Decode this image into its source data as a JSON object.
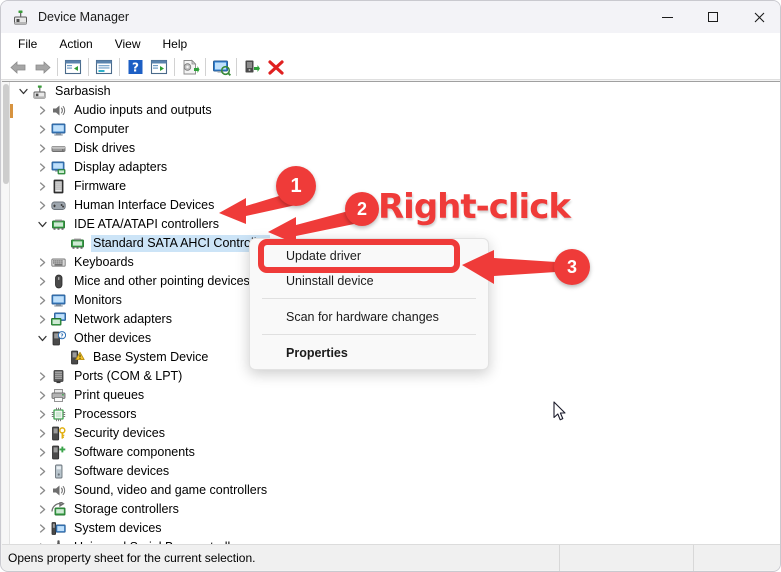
{
  "window": {
    "title": "Device Manager",
    "icon": "device-manager-icon",
    "controls": {
      "minimize": "–",
      "maximize": "☐",
      "close": "✕"
    }
  },
  "menubar": {
    "items": [
      {
        "label": "File",
        "name": "menu-file"
      },
      {
        "label": "Action",
        "name": "menu-action"
      },
      {
        "label": "View",
        "name": "menu-view"
      },
      {
        "label": "Help",
        "name": "menu-help"
      }
    ]
  },
  "toolbar": {
    "buttons": [
      {
        "name": "back-icon",
        "title": "Back"
      },
      {
        "name": "forward-icon",
        "title": "Forward"
      },
      {
        "name": "show-hide-console-tree-icon",
        "title": "Show/Hide Console Tree"
      },
      {
        "name": "properties-icon",
        "title": "Properties"
      },
      {
        "name": "help-icon",
        "title": "Help"
      },
      {
        "name": "show-hide-action-pane-icon",
        "title": "Show/Hide Action Pane"
      },
      {
        "name": "update-driver-icon",
        "title": "Update driver"
      },
      {
        "name": "scan-hardware-changes-icon",
        "title": "Scan for hardware changes"
      },
      {
        "name": "enable-device-icon",
        "title": "Enable device"
      },
      {
        "name": "uninstall-device-icon",
        "title": "Uninstall device"
      }
    ]
  },
  "tree": {
    "root": {
      "label": "Sarbasish",
      "icon": "computer-root-icon",
      "expanded": true
    },
    "items": [
      {
        "label": "Audio inputs and outputs",
        "icon": "speaker-icon",
        "expanded": false,
        "depth": 1
      },
      {
        "label": "Computer",
        "icon": "monitor-icon",
        "expanded": false,
        "depth": 1
      },
      {
        "label": "Disk drives",
        "icon": "disk-drive-icon",
        "expanded": false,
        "depth": 1
      },
      {
        "label": "Display adapters",
        "icon": "display-adapter-icon",
        "expanded": false,
        "depth": 1
      },
      {
        "label": "Firmware",
        "icon": "firmware-icon",
        "expanded": false,
        "depth": 1
      },
      {
        "label": "Human Interface Devices",
        "icon": "hid-icon",
        "expanded": false,
        "depth": 1
      },
      {
        "label": "IDE ATA/ATAPI controllers",
        "icon": "ide-controller-icon",
        "expanded": true,
        "depth": 1
      },
      {
        "label": "Standard SATA AHCI Controller",
        "icon": "ide-controller-icon",
        "expanded": null,
        "depth": 2,
        "selected": true
      },
      {
        "label": "Keyboards",
        "icon": "keyboard-icon",
        "expanded": false,
        "depth": 1
      },
      {
        "label": "Mice and other pointing devices",
        "icon": "mouse-icon",
        "expanded": false,
        "depth": 1
      },
      {
        "label": "Monitors",
        "icon": "monitor-icon",
        "expanded": false,
        "depth": 1
      },
      {
        "label": "Network adapters",
        "icon": "network-adapter-icon",
        "expanded": false,
        "depth": 1
      },
      {
        "label": "Other devices",
        "icon": "unknown-device-icon",
        "expanded": true,
        "depth": 1
      },
      {
        "label": "Base System Device",
        "icon": "warning-device-icon",
        "expanded": null,
        "depth": 2
      },
      {
        "label": "Ports (COM & LPT)",
        "icon": "port-icon",
        "expanded": false,
        "depth": 1
      },
      {
        "label": "Print queues",
        "icon": "printer-icon",
        "expanded": false,
        "depth": 1
      },
      {
        "label": "Processors",
        "icon": "processor-icon",
        "expanded": false,
        "depth": 1
      },
      {
        "label": "Security devices",
        "icon": "security-device-icon",
        "expanded": false,
        "depth": 1
      },
      {
        "label": "Software components",
        "icon": "software-component-icon",
        "expanded": false,
        "depth": 1
      },
      {
        "label": "Software devices",
        "icon": "software-device-icon",
        "expanded": false,
        "depth": 1
      },
      {
        "label": "Sound, video and game controllers",
        "icon": "speaker-icon",
        "expanded": false,
        "depth": 1
      },
      {
        "label": "Storage controllers",
        "icon": "storage-controller-icon",
        "expanded": false,
        "depth": 1
      },
      {
        "label": "System devices",
        "icon": "system-device-icon",
        "expanded": false,
        "depth": 1
      },
      {
        "label": "Universal Serial Bus controllers",
        "icon": "usb-icon",
        "expanded": false,
        "depth": 1
      }
    ]
  },
  "context_menu": {
    "items": [
      {
        "label": "Update driver",
        "name": "ctx-update-driver",
        "bold": false,
        "highlighted": true
      },
      {
        "label": "Uninstall device",
        "name": "ctx-uninstall-device",
        "bold": false
      },
      {
        "type": "separator"
      },
      {
        "label": "Scan for hardware changes",
        "name": "ctx-scan-hardware-changes",
        "bold": false
      },
      {
        "type": "separator"
      },
      {
        "label": "Properties",
        "name": "ctx-properties",
        "bold": true
      }
    ]
  },
  "annotations": {
    "accent_color": "#ef3b39",
    "badges": [
      {
        "text": "1",
        "name": "annotation-badge-1"
      },
      {
        "text": "2",
        "name": "annotation-badge-2"
      },
      {
        "text": "3",
        "name": "annotation-badge-3"
      }
    ],
    "callout_text": "Right-click"
  },
  "statusbar": {
    "message": "Opens property sheet for the current selection.",
    "panel2": "",
    "panel3": ""
  }
}
